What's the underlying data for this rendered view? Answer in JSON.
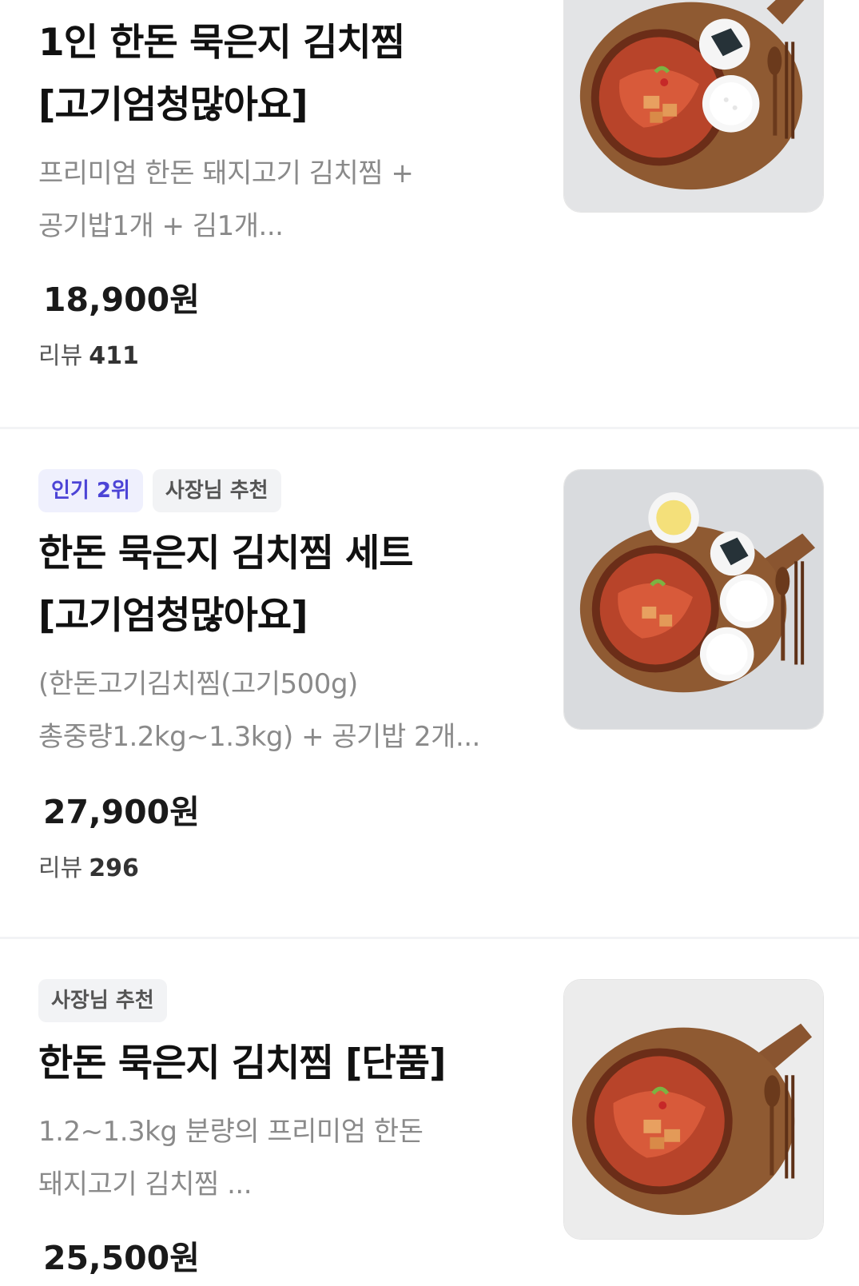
{
  "menu": {
    "items": [
      {
        "badges": [],
        "title_line1": "1인 한돈 묵은지 김치찜",
        "title_line2": "[고기엄청많아요]",
        "desc_line1": "프리미엄 한돈 돼지고기 김치찜 +",
        "desc_line2": "공기밥1개 + 김1개...",
        "price": "18,900원",
        "reviews_label": "리뷰",
        "reviews_count": "411",
        "image_icon": "kimchi-stew-image"
      },
      {
        "badges": [
          "인기 2위",
          "사장님 추천"
        ],
        "title_line1": "한돈 묵은지 김치찜 세트",
        "title_line2": "[고기엄청많아요]",
        "desc_line1": "(한돈고기김치찜(고기500g)",
        "desc_line2": "총중량1.2kg~1.3kg)  + 공기밥 2개...",
        "price": "27,900원",
        "reviews_label": "리뷰",
        "reviews_count": "296",
        "image_icon": "kimchi-stew-set-image"
      },
      {
        "badges": [
          "사장님 추천"
        ],
        "title_line1": "한돈 묵은지 김치찜 [단품]",
        "desc_line1": "1.2~1.3kg 분량의 프리미엄 한돈",
        "desc_line2": "돼지고기 김치찜 ...",
        "price": "25,500원",
        "image_icon": "kimchi-stew-single-image"
      }
    ]
  },
  "colors": {
    "popular_badge_bg": "#eff0fd",
    "popular_badge_text": "#4c44d6",
    "owner_badge_bg": "#f2f3f5",
    "divider": "#f2f3f5"
  }
}
